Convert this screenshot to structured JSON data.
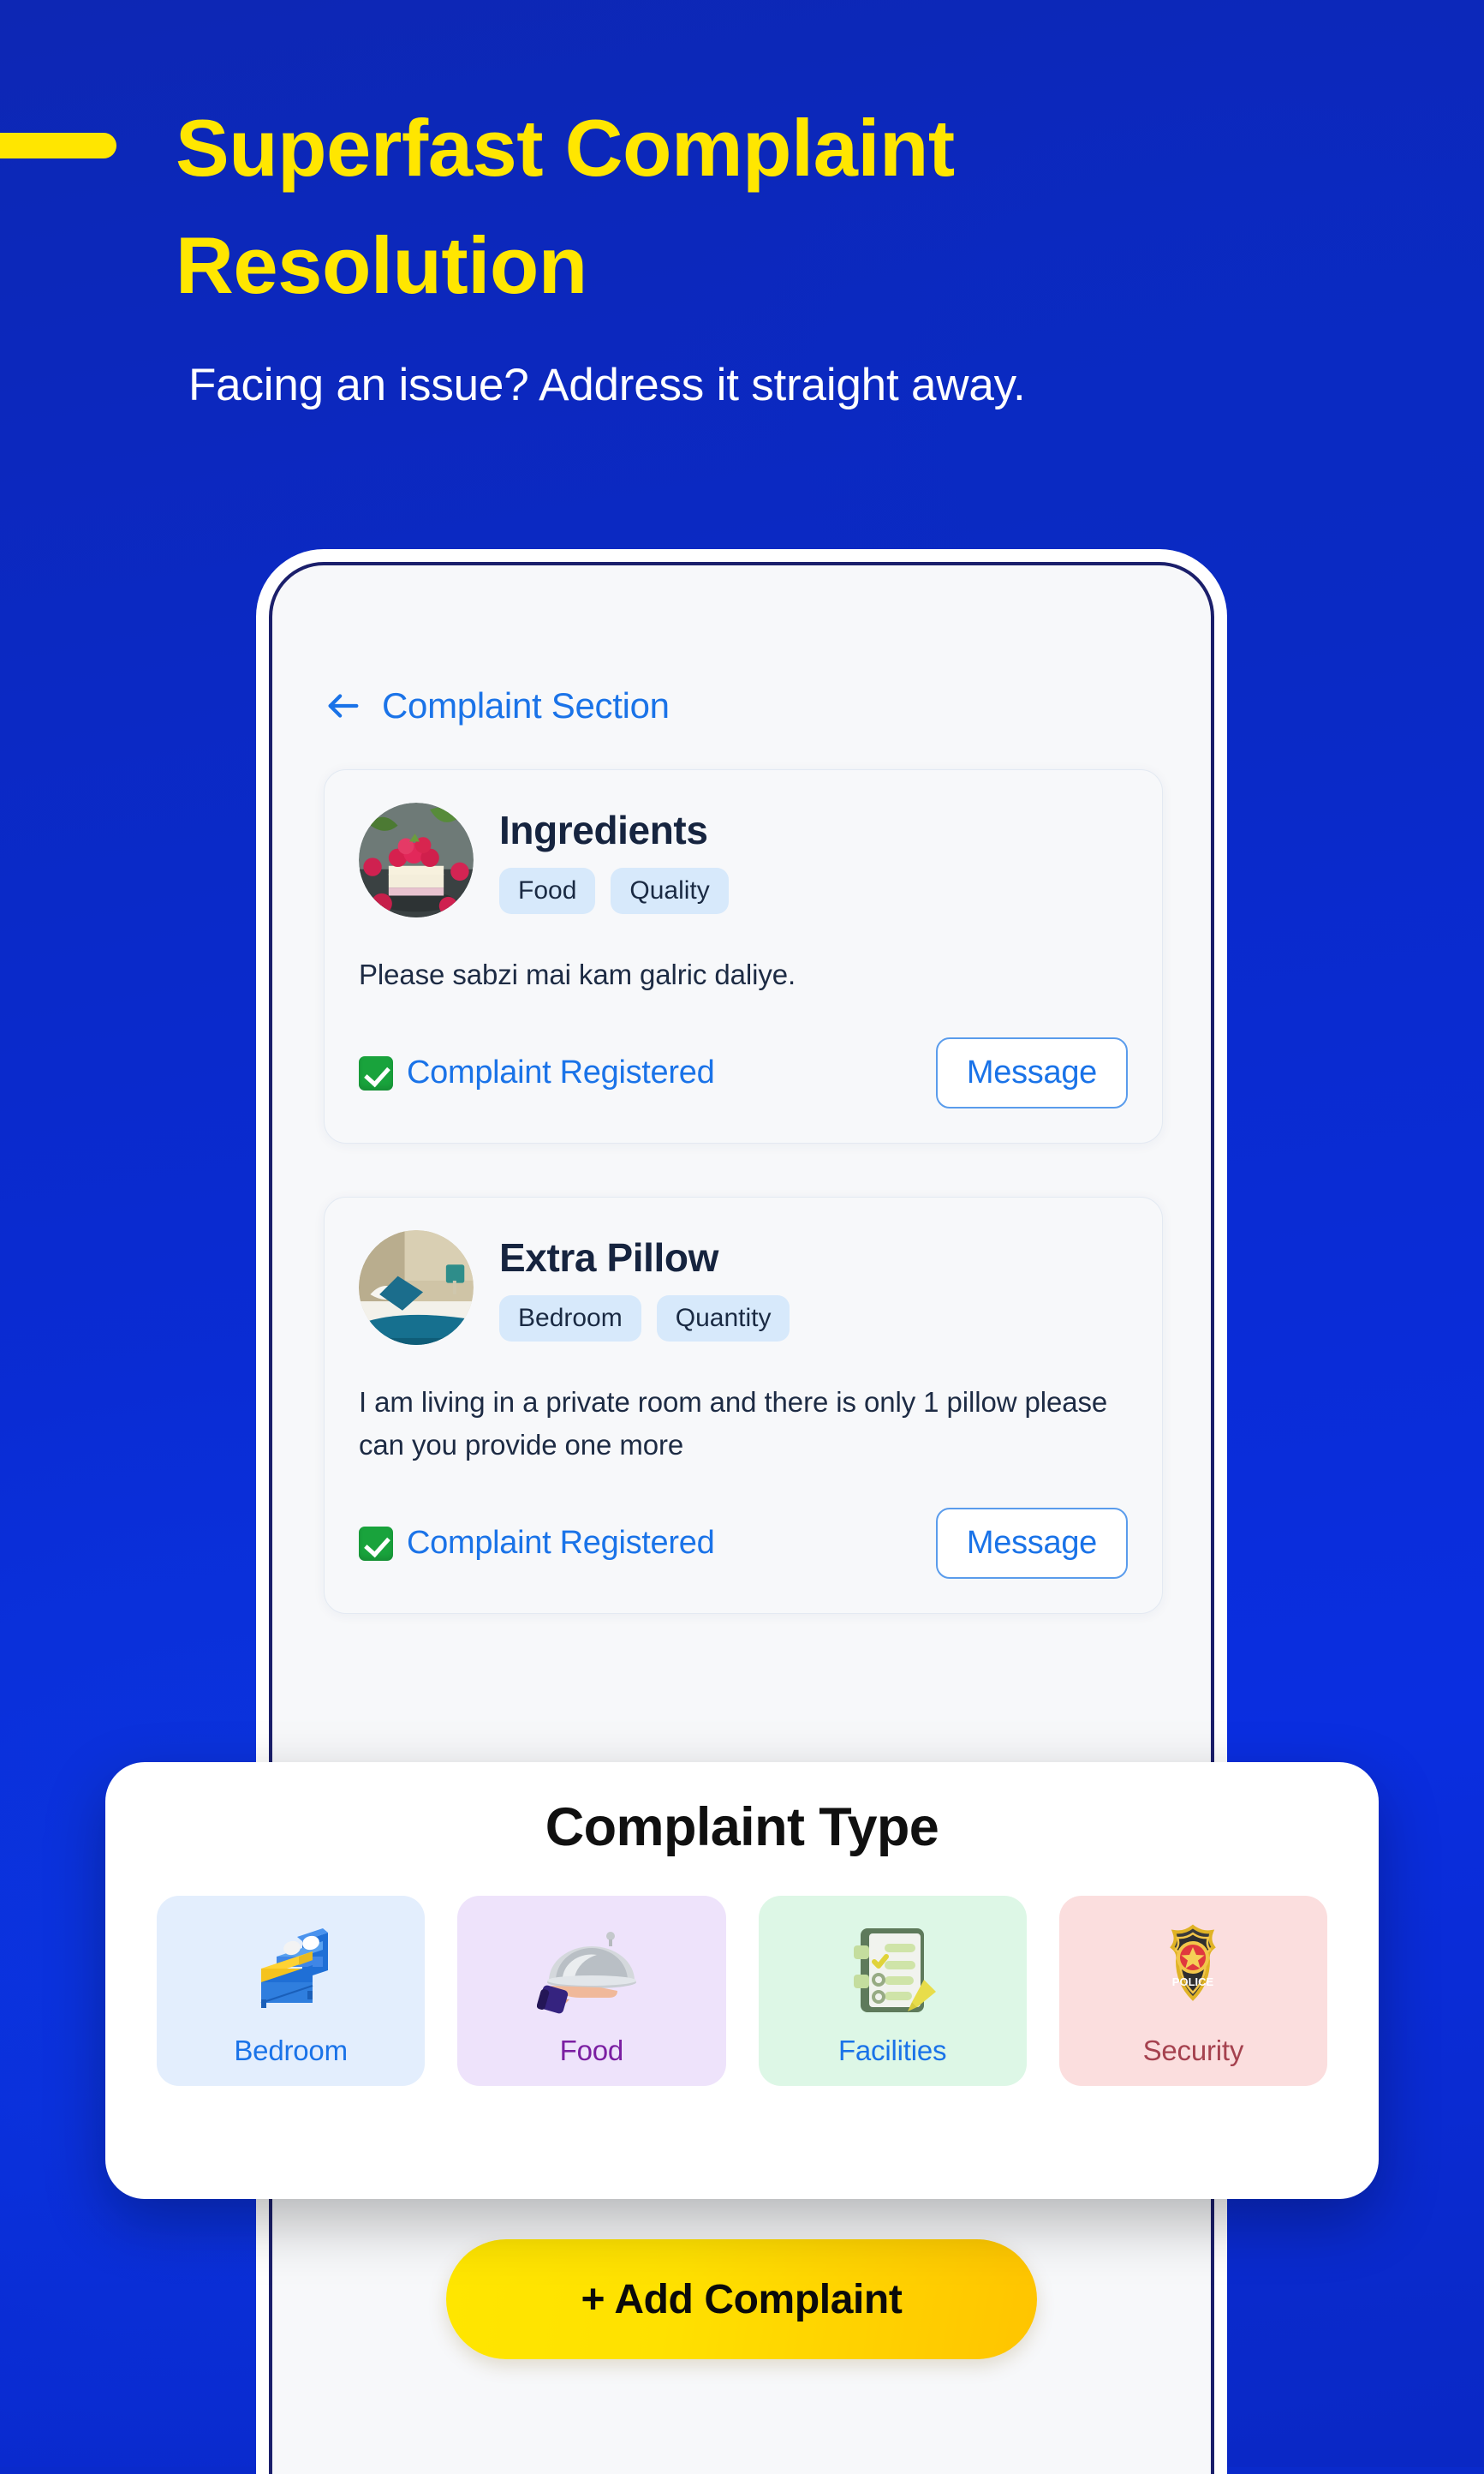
{
  "hero": {
    "headline": "Superfast Complaint Resolution",
    "subhead": "Facing an issue? Address it straight away.",
    "accent_color": "#ffe600",
    "background_color": "#0a2acb",
    "dash_icon": "yellow-dash-accent"
  },
  "app": {
    "back_icon": "back-arrow-icon",
    "title": "Complaint Section",
    "title_color": "#1a73e8"
  },
  "complaints": [
    {
      "avatar_icon": "raspberry-cake-photo",
      "title": "Ingredients",
      "tags": [
        "Food",
        "Quality"
      ],
      "description": "Please sabzi mai kam galric daliye.",
      "status_icon": "check-mark-green-icon",
      "status": "Complaint Registered",
      "action_label": "Message"
    },
    {
      "avatar_icon": "bedroom-pillow-photo",
      "title": "Extra Pillow",
      "tags": [
        "Bedroom",
        "Quantity"
      ],
      "description": "I am living in a private room and there is only 1 pillow please can you provide one more",
      "status_icon": "check-mark-green-icon",
      "status": "Complaint Registered",
      "action_label": "Message"
    }
  ],
  "add_button": {
    "label": "+ Add Complaint",
    "color": "#ffe100"
  },
  "modal": {
    "title": "Complaint Type",
    "types": [
      {
        "label": "Bedroom",
        "icon": "bed-icon",
        "bg": "#e3eefd",
        "text_color": "#1a73e8"
      },
      {
        "label": "Food",
        "icon": "cloche-server-icon",
        "bg": "#eee3fb",
        "text_color": "#7b1fa2"
      },
      {
        "label": "Facilities",
        "icon": "clipboard-list-icon",
        "bg": "#ddf7e6",
        "text_color": "#1a73e8"
      },
      {
        "label": "Security",
        "icon": "police-badge-icon",
        "bg": "#fbdede",
        "text_color": "#a5424f"
      }
    ]
  }
}
